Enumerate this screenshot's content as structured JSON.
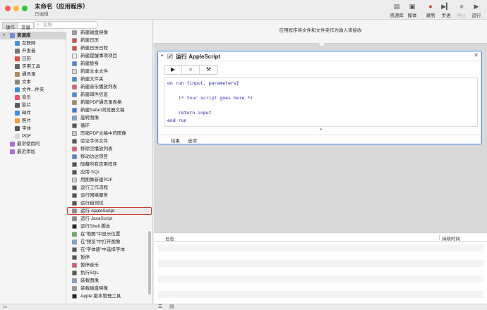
{
  "window": {
    "title": "未命名（应用程序）",
    "subtitle": "已编辑"
  },
  "toolbar": {
    "buttons": [
      {
        "label": "资源库",
        "icon": "library-icon"
      },
      {
        "label": "媒体",
        "icon": "media-icon"
      },
      {
        "label": "录制",
        "icon": "record-icon"
      },
      {
        "label": "步进",
        "icon": "step-icon"
      },
      {
        "label": "停止",
        "icon": "stop-icon"
      },
      {
        "label": "运行",
        "icon": "run-icon"
      }
    ]
  },
  "sidebar": {
    "segments": [
      "操作",
      "变量"
    ],
    "search_placeholder": "名称",
    "library": [
      {
        "label": "资源库",
        "icon": "library-folder-icon",
        "color": "#6e8fd6",
        "top": true
      },
      {
        "label": "互联网",
        "icon": "internet-icon",
        "color": "#4a90e2"
      },
      {
        "label": "开发者",
        "icon": "developer-icon",
        "color": "#777777"
      },
      {
        "label": "日历",
        "icon": "calendar-icon",
        "color": "#e94b3c"
      },
      {
        "label": "实用工具",
        "icon": "utilities-icon",
        "color": "#666666"
      },
      {
        "label": "通讯录",
        "icon": "contacts-icon",
        "color": "#b58a5a"
      },
      {
        "label": "文本",
        "icon": "text-icon",
        "color": "#888888"
      },
      {
        "label": "文件...件夹",
        "icon": "finder-icon",
        "color": "#3d8be0"
      },
      {
        "label": "音乐",
        "icon": "music-icon",
        "color": "#f0506e"
      },
      {
        "label": "影片",
        "icon": "movies-icon",
        "color": "#5a5a5a"
      },
      {
        "label": "邮件",
        "icon": "mail-icon",
        "color": "#3b8fe6"
      },
      {
        "label": "照片",
        "icon": "photos-icon",
        "color": "#f29b38"
      },
      {
        "label": "字体",
        "icon": "fonts-icon",
        "color": "#555555"
      },
      {
        "label": "PDF",
        "icon": "pdf-icon",
        "color": "#d9d9d9"
      },
      {
        "label": "最常使用的",
        "icon": "most-used-folder-icon",
        "color": "#b06bd6",
        "top": true
      },
      {
        "label": "最近添加",
        "icon": "recently-added-folder-icon",
        "color": "#b06bd6",
        "top": true
      }
    ],
    "actions": [
      {
        "label": "新建磁盘映像",
        "icon": "disk-image-icon",
        "color": "#9a9a9a"
      },
      {
        "label": "新建日历",
        "icon": "calendar-icon",
        "color": "#e94b3c"
      },
      {
        "label": "新建日历日程",
        "icon": "calendar-icon",
        "color": "#e94b3c"
      },
      {
        "label": "新建提醒事项项目",
        "icon": "reminders-icon",
        "color": "#f0f0f0"
      },
      {
        "label": "新建替身",
        "icon": "finder-icon",
        "color": "#3d8be0"
      },
      {
        "label": "新建文本文件",
        "icon": "text-file-icon",
        "color": "#dddddd"
      },
      {
        "label": "新建文件夹",
        "icon": "finder-icon",
        "color": "#3d8be0"
      },
      {
        "label": "新建音乐播放列表",
        "icon": "music-icon",
        "color": "#f0506e"
      },
      {
        "label": "新建邮件信息",
        "icon": "mail-icon",
        "color": "#3b8fe6"
      },
      {
        "label": "新建PDF通讯录表格",
        "icon": "contacts-icon",
        "color": "#b58a5a"
      },
      {
        "label": "新建Safari浏览器文稿",
        "icon": "safari-icon",
        "color": "#2f7de0"
      },
      {
        "label": "旋转图像",
        "icon": "preview-icon",
        "color": "#7aa7d9"
      },
      {
        "label": "循环",
        "icon": "automator-icon",
        "color": "#555555"
      },
      {
        "label": "压缩PDF文稿中的图像",
        "icon": "pdf-icon",
        "color": "#cccccc"
      },
      {
        "label": "验证字体文件",
        "icon": "fonts-icon",
        "color": "#555555"
      },
      {
        "label": "移除空播放列表",
        "icon": "music-icon",
        "color": "#f0506e"
      },
      {
        "label": "移动访达项目",
        "icon": "finder-icon",
        "color": "#3d8be0"
      },
      {
        "label": "隐藏所有应用程序",
        "icon": "automator-icon",
        "color": "#555555"
      },
      {
        "label": "应用 SQL",
        "icon": "automator-icon",
        "color": "#555555"
      },
      {
        "label": "用图像新建PDF",
        "icon": "pdf-icon",
        "color": "#cccccc"
      },
      {
        "label": "运行工作流程",
        "icon": "automator-icon",
        "color": "#555555"
      },
      {
        "label": "运行网络服务",
        "icon": "automator-icon",
        "color": "#555555"
      },
      {
        "label": "运行自测试",
        "icon": "automator-icon",
        "color": "#555555"
      },
      {
        "label": "运行 AppleScript",
        "icon": "script-icon",
        "color": "#8a8a8a",
        "selected": true
      },
      {
        "label": "运行 JavaScript",
        "icon": "script-icon",
        "color": "#8a8a8a"
      },
      {
        "label": "运行Shell 脚本",
        "icon": "terminal-icon",
        "color": "#222222"
      },
      {
        "label": "在“地图”中显示位置",
        "icon": "maps-icon",
        "color": "#5cb85c"
      },
      {
        "label": "在“预览”中打开图像",
        "icon": "preview-icon",
        "color": "#7aa7d9"
      },
      {
        "label": "在“字体册”中选择字体",
        "icon": "fonts-icon",
        "color": "#555555"
      },
      {
        "label": "暂停",
        "icon": "automator-icon",
        "color": "#555555"
      },
      {
        "label": "暂停音乐",
        "icon": "music-icon",
        "color": "#f0506e"
      },
      {
        "label": "执行SQL",
        "icon": "automator-icon",
        "color": "#555555"
      },
      {
        "label": "装载图像",
        "icon": "preview-icon",
        "color": "#7aa7d9"
      },
      {
        "label": "装载磁盘映像",
        "icon": "disk-image-icon",
        "color": "#9a9a9a"
      },
      {
        "label": "Apple 版本管理工具",
        "icon": "terminal-icon",
        "color": "#222222"
      }
    ]
  },
  "workflow": {
    "header_text": "应用程序将文件和文件夹作为输入来接收",
    "action": {
      "title": "运行 AppleScript",
      "code_lines": [
        {
          "text": "on run {input, parameters}",
          "cls": "kw"
        },
        {
          "text": "",
          "cls": ""
        },
        {
          "text": "    (* Your script goes here *)",
          "cls": "cm"
        },
        {
          "text": "",
          "cls": ""
        },
        {
          "text": "    return input",
          "cls": "kw"
        },
        {
          "text": "end run",
          "cls": "kw"
        }
      ],
      "tabs": [
        "结果",
        "选项"
      ]
    }
  },
  "log": {
    "col_log": "日志",
    "col_duration": "持续时间"
  },
  "accent_color": "#3b82f6",
  "selection_outline_color": "#d33c2c"
}
